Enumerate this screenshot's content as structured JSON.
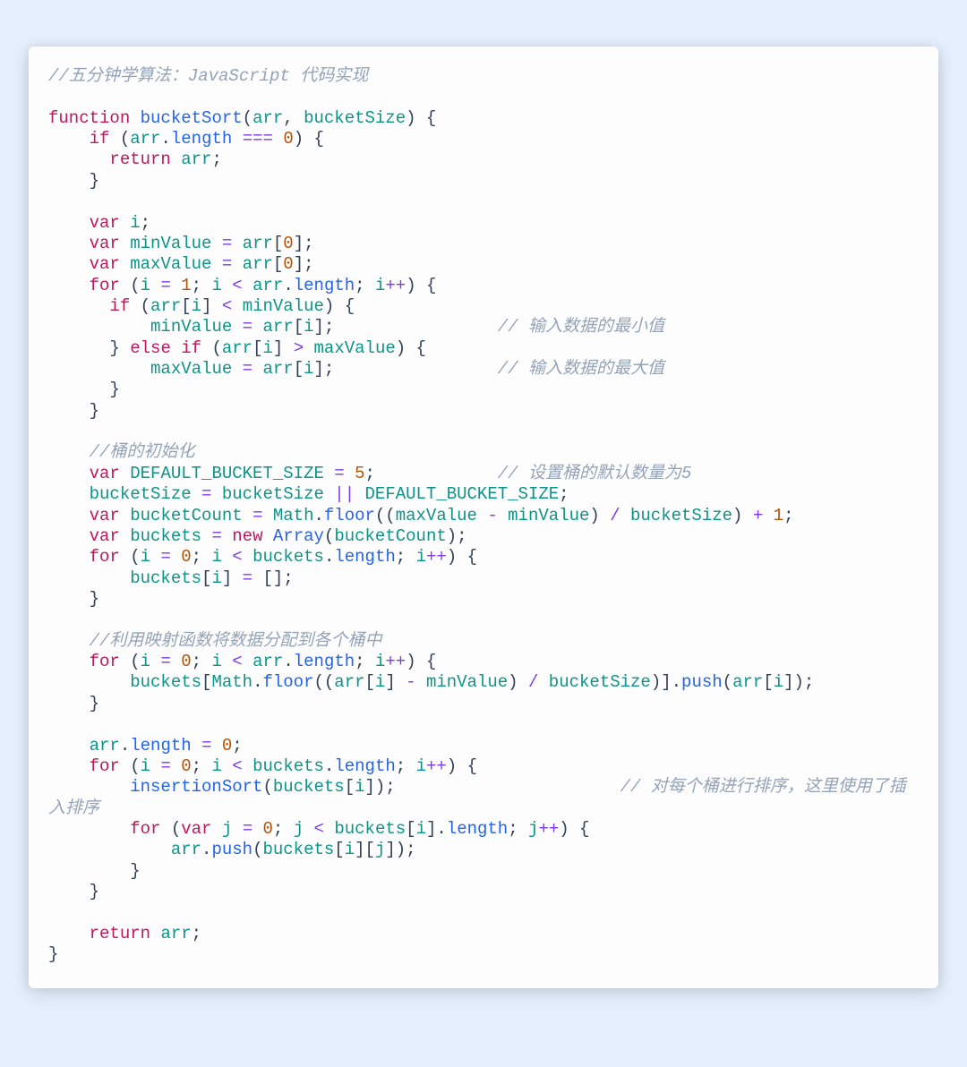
{
  "code": {
    "c_header": "//五分钟学算法：JavaScript 代码实现",
    "kw_function": "function",
    "kw_if": "if",
    "kw_else": "else",
    "kw_for": "for",
    "kw_return": "return",
    "kw_var": "var",
    "kw_new": "new",
    "fn_bucketSort": "bucketSort",
    "p_arr": "arr",
    "p_bSize": "bucketSize",
    "p_length": "length",
    "p_i": "i",
    "p_j": "j",
    "p_minValue": "minValue",
    "p_maxValue": "maxValue",
    "p_DEFAULT": "DEFAULT_BUCKET_SIZE",
    "p_bucketCount": "bucketCount",
    "p_buckets": "buckets",
    "fn_Math": "Math",
    "fn_floor": "floor",
    "fn_Array": "Array",
    "fn_push": "push",
    "fn_insertionSort": "insertionSort",
    "op_eq3": "===",
    "op_as": "=",
    "op_lt": "<",
    "op_gt": ">",
    "op_pp": "++",
    "op_or": "||",
    "op_minus": "-",
    "op_div": "/",
    "op_plus": "+",
    "n0": "0",
    "n1": "1",
    "n5": "5",
    "c_min": "// 输入数据的最小值",
    "c_max": "// 输入数据的最大值",
    "c_bucketInit": "//桶的初始化",
    "c_defaultCount": "// 设置桶的默认数量为5",
    "c_map": "//利用映射函数将数据分配到各个桶中",
    "c_sortEach": "// 对每个桶进行排序，这里使用了插入排序"
  }
}
